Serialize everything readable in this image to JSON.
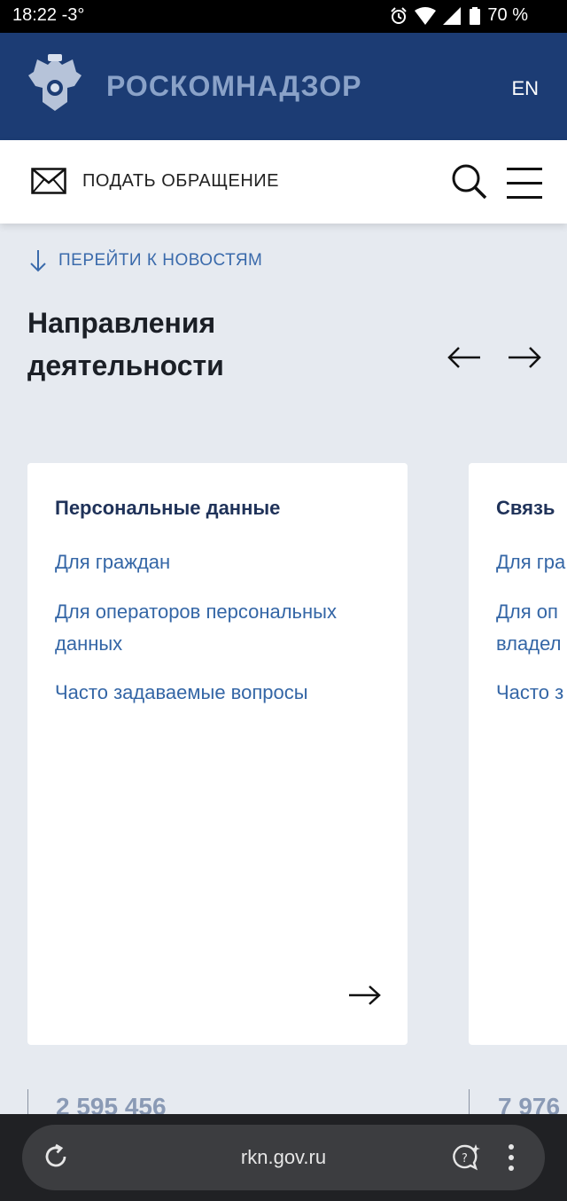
{
  "status": {
    "time": "18:22",
    "temp": "-3°",
    "battery": "70 %",
    "icons": [
      "alarm-icon",
      "wifi-icon",
      "signal-icon",
      "battery-icon"
    ]
  },
  "header": {
    "brand": "РОСКОМНАДЗОР",
    "lang": "EN",
    "colors": {
      "background": "#1c3c74",
      "brand_text": "#8aa2c8"
    }
  },
  "toolbar": {
    "appeal_label": "ПОДАТЬ ОБРАЩЕНИЕ",
    "icons": [
      "mail-icon",
      "search-icon",
      "menu-icon"
    ]
  },
  "news_link": "ПЕРЕЙТИ К НОВОСТЯМ",
  "section": {
    "title_line1": "Направления",
    "title_line2": "деятельности"
  },
  "cards": [
    {
      "title": "Персональные данные",
      "links": [
        "Для граждан",
        "Для операторов персональных",
        "данных",
        "Часто задаваемые вопросы"
      ]
    },
    {
      "title": "Связь",
      "links": [
        "Для гра",
        "Для оп",
        "владел",
        "Часто з"
      ]
    }
  ],
  "stats": [
    "2 595 456",
    "7 976"
  ],
  "browser": {
    "url": "rkn.gov.ru",
    "icons": [
      "reload-icon",
      "chat-sparkle-icon",
      "more-vert-icon"
    ]
  }
}
